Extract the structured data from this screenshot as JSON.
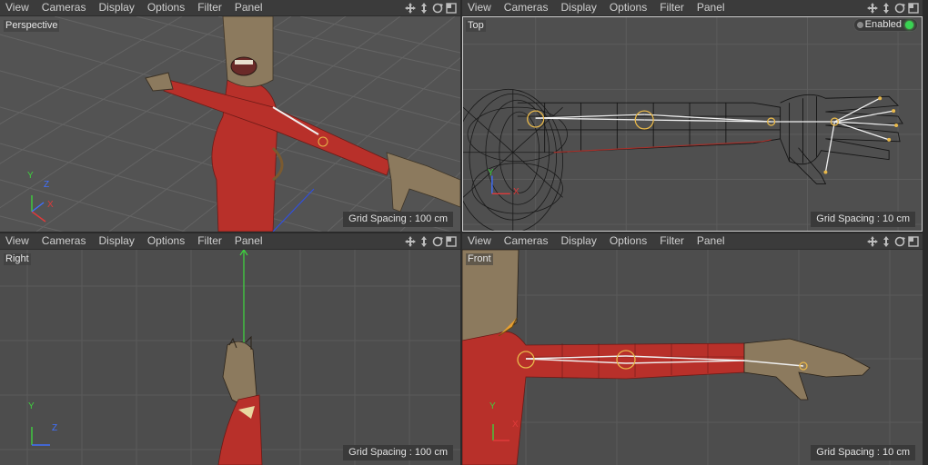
{
  "menu": [
    "View",
    "Cameras",
    "Display",
    "Options",
    "Filter",
    "Panel"
  ],
  "nav_icons": [
    "move-view-icon",
    "pan-view-icon",
    "rotate-view-icon",
    "maximize-view-icon"
  ],
  "viewports": {
    "perspective": {
      "label": "Perspective",
      "grid_spacing": "Grid Spacing : 100 cm"
    },
    "top": {
      "label": "Top",
      "grid_spacing": "Grid Spacing : 10 cm",
      "enabled_label": "Enabled"
    },
    "right": {
      "label": "Right",
      "grid_spacing": "Grid Spacing : 100 cm"
    },
    "front": {
      "label": "Front",
      "grid_spacing": "Grid Spacing : 10 cm"
    }
  },
  "axes": {
    "x": "X",
    "y": "Y",
    "z": "Z"
  },
  "colors": {
    "viewport_bg": "#4d4d4d",
    "menubar_bg": "#3b3b3b",
    "mesh_red": "#b8302a",
    "grid_line": "#5b5b5b",
    "enabled_led": "#39d353"
  }
}
